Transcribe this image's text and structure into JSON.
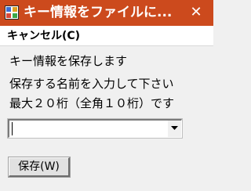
{
  "window": {
    "title": "キー情報をファイルに...",
    "close_label": "✕",
    "accent_color": "#cc4a1d"
  },
  "menu": {
    "items": [
      {
        "label": "キャンセル(C)"
      }
    ]
  },
  "content": {
    "line1": "キー情報を保存します",
    "line2": "保存する名前を入力して下さい",
    "line3": "最大２０桁（全角１０桁）です"
  },
  "name_combo": {
    "value": ""
  },
  "buttons": {
    "save_label": "保存(W)"
  }
}
